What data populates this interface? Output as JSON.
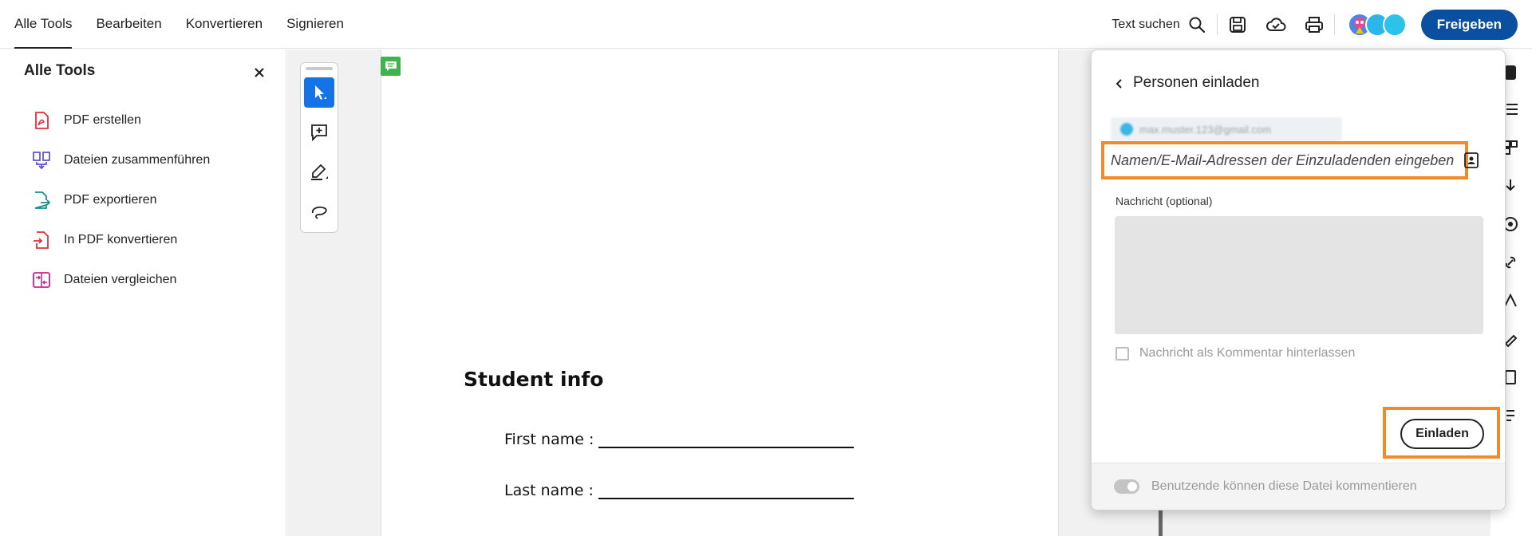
{
  "header": {
    "tabs": [
      {
        "label": "Alle Tools",
        "active": true
      },
      {
        "label": "Bearbeiten"
      },
      {
        "label": "Konvertieren"
      },
      {
        "label": "Signieren"
      }
    ],
    "search_label": "Text suchen",
    "share_button": "Freigeben",
    "accent_color": "#0a4fa0",
    "icons": [
      "search-icon",
      "save-icon",
      "cloud-icon",
      "print-icon"
    ]
  },
  "left_panel": {
    "title": "Alle Tools",
    "items": [
      {
        "label": "PDF erstellen",
        "icon": "create-pdf-icon",
        "color": "#e0303b"
      },
      {
        "label": "Dateien zusammenführen",
        "icon": "combine-files-icon",
        "color": "#5a4fd1"
      },
      {
        "label": "PDF exportieren",
        "icon": "export-pdf-icon",
        "color": "#1a8f8a"
      },
      {
        "label": "In PDF konvertieren",
        "icon": "convert-pdf-icon",
        "color": "#e0303b"
      },
      {
        "label": "Dateien vergleichen",
        "icon": "compare-files-icon",
        "color": "#c7248a"
      }
    ]
  },
  "toolstrip": {
    "tools": [
      "select-cursor-icon",
      "add-comment-icon",
      "highlight-pen-icon",
      "draw-lasso-icon"
    ]
  },
  "document": {
    "heading": "Student info",
    "fields": [
      {
        "label": "First name :"
      },
      {
        "label": "Last name :"
      }
    ]
  },
  "invite_panel": {
    "title": "Personen einladen",
    "recipient_chip": "max.muster.123@gmail.com",
    "input_placeholder": "Namen/E-Mail-Adressen der Einzuladenden eingeben",
    "message_label": "Nachricht (optional)",
    "checkbox_label": "Nachricht als Kommentar hinterlassen",
    "invite_button": "Einladen",
    "footer_toggle_label": "Benutzende können diese Datei kommentieren",
    "highlight_color": "#f08a2c"
  }
}
